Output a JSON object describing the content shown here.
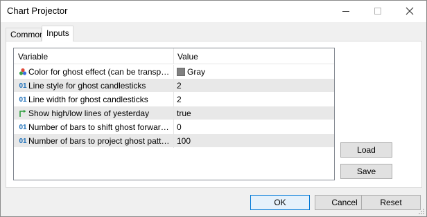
{
  "window": {
    "title": "Chart Projector"
  },
  "tabs": [
    {
      "label": "Common"
    },
    {
      "label": "Inputs"
    }
  ],
  "grid": {
    "columns": [
      "Variable",
      "Value"
    ],
    "rows": [
      {
        "icon": "color-palette-icon",
        "variable": "Color for ghost effect (can be transpare...",
        "value": "Gray",
        "swatch": "#808080"
      },
      {
        "icon": "integer-icon",
        "variable": "Line style for ghost candlesticks",
        "value": "2"
      },
      {
        "icon": "integer-icon",
        "variable": "Line width for ghost candlesticks",
        "value": "2"
      },
      {
        "icon": "boolean-arrow-icon",
        "variable": "Show high/low lines of yesterday",
        "value": "true"
      },
      {
        "icon": "integer-icon",
        "variable": "Number of bars to shift ghost forward/b...",
        "value": "0"
      },
      {
        "icon": "integer-icon",
        "variable": "Number of bars to project ghost pattern...",
        "value": "100"
      }
    ]
  },
  "buttons": {
    "load": "Load",
    "save": "Save",
    "ok": "OK",
    "cancel": "Cancel",
    "reset": "Reset"
  },
  "icons": {
    "integer_glyph": "01"
  }
}
